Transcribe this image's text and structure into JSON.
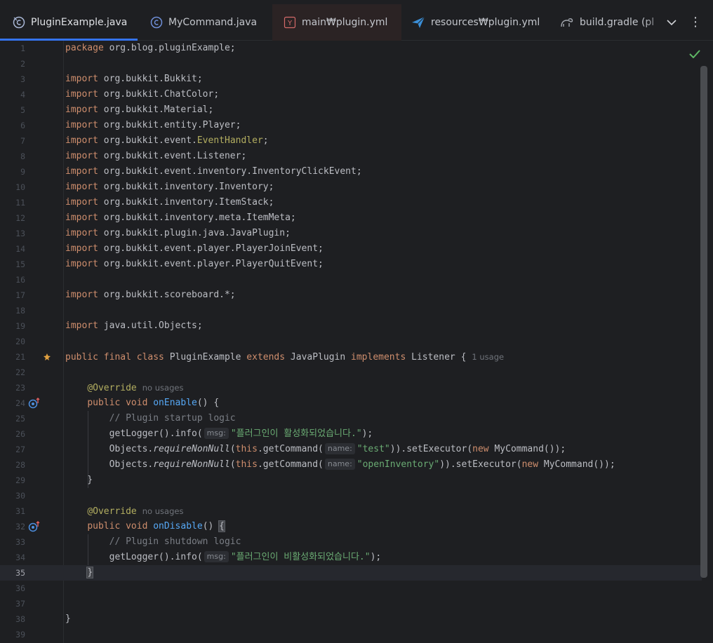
{
  "tabs": [
    {
      "label": "PluginExample.java",
      "icon": "java-class-icon",
      "active": true,
      "close": "✕"
    },
    {
      "label": "MyCommand.java",
      "icon": "java-class-icon"
    },
    {
      "label": "main₩plugin.yml",
      "icon": "yaml-icon"
    },
    {
      "label": "resources₩plugin.yml",
      "icon": "plugin-yml-icon"
    },
    {
      "label": "build.gradle (plu",
      "icon": "gradle-icon"
    }
  ],
  "tab_tools": {
    "more": "⋮"
  },
  "editor": {
    "current_line": 35,
    "inspection_status": "no-problems-check",
    "lines": [
      {
        "n": "1",
        "t": "package org.blog.pluginExample;"
      },
      {
        "n": "2",
        "t": ""
      },
      {
        "n": "3",
        "t": "import org.bukkit.Bukkit;"
      },
      {
        "n": "4",
        "t": "import org.bukkit.ChatColor;"
      },
      {
        "n": "5",
        "t": "import org.bukkit.Material;"
      },
      {
        "n": "6",
        "t": "import org.bukkit.entity.Player;"
      },
      {
        "n": "7",
        "t": "import org.bukkit.event.EventHandler;"
      },
      {
        "n": "8",
        "t": "import org.bukkit.event.Listener;"
      },
      {
        "n": "9",
        "t": "import org.bukkit.event.inventory.InventoryClickEvent;"
      },
      {
        "n": "10",
        "t": "import org.bukkit.inventory.Inventory;"
      },
      {
        "n": "11",
        "t": "import org.bukkit.inventory.ItemStack;"
      },
      {
        "n": "12",
        "t": "import org.bukkit.inventory.meta.ItemMeta;"
      },
      {
        "n": "13",
        "t": "import org.bukkit.plugin.java.JavaPlugin;"
      },
      {
        "n": "14",
        "t": "import org.bukkit.event.player.PlayerJoinEvent;"
      },
      {
        "n": "15",
        "t": "import org.bukkit.event.player.PlayerQuitEvent;"
      },
      {
        "n": "16",
        "t": ""
      },
      {
        "n": "17",
        "t": "import org.bukkit.scoreboard.*;"
      },
      {
        "n": "18",
        "t": ""
      },
      {
        "n": "19",
        "t": "import java.util.Objects;"
      },
      {
        "n": "20",
        "t": ""
      },
      {
        "n": "21",
        "t": "public final class PluginExample extends JavaPlugin implements Listener {",
        "usage": "1 usage"
      },
      {
        "n": "22",
        "t": ""
      },
      {
        "n": "23",
        "t": "    @Override",
        "usage": "no usages"
      },
      {
        "n": "24",
        "t": "    public void onEnable() {"
      },
      {
        "n": "25",
        "t": "        // Plugin startup logic"
      },
      {
        "n": "26",
        "t": "        getLogger().info(\"플러그인이 활성화되었습니다.\");",
        "hint": "msg:"
      },
      {
        "n": "27",
        "t": "        Objects.requireNonNull(this.getCommand(\"test\")).setExecutor(new MyCommand());",
        "hint": "name:"
      },
      {
        "n": "28",
        "t": "        Objects.requireNonNull(this.getCommand(\"openInventory\")).setExecutor(new MyCommand());",
        "hint": "name:"
      },
      {
        "n": "29",
        "t": "    }"
      },
      {
        "n": "30",
        "t": ""
      },
      {
        "n": "31",
        "t": "    @Override",
        "usage": "no usages"
      },
      {
        "n": "32",
        "t": "    public void onDisable() {"
      },
      {
        "n": "33",
        "t": "        // Plugin shutdown logic"
      },
      {
        "n": "34",
        "t": "        getLogger().info(\"플러그인이 비활성화되었습니다.\");",
        "hint": "msg:"
      },
      {
        "n": "35",
        "t": "    }"
      },
      {
        "n": "36",
        "t": ""
      },
      {
        "n": "37",
        "t": ""
      },
      {
        "n": "38",
        "t": "}"
      },
      {
        "n": "39",
        "t": ""
      }
    ]
  },
  "colors": {
    "background": "#1e1f22",
    "keyword": "#cf8e6d",
    "annotation": "#b3ae60",
    "method": "#56a8f5",
    "string": "#6aab73",
    "comment": "#7a7e85",
    "accent": "#3574f0"
  }
}
